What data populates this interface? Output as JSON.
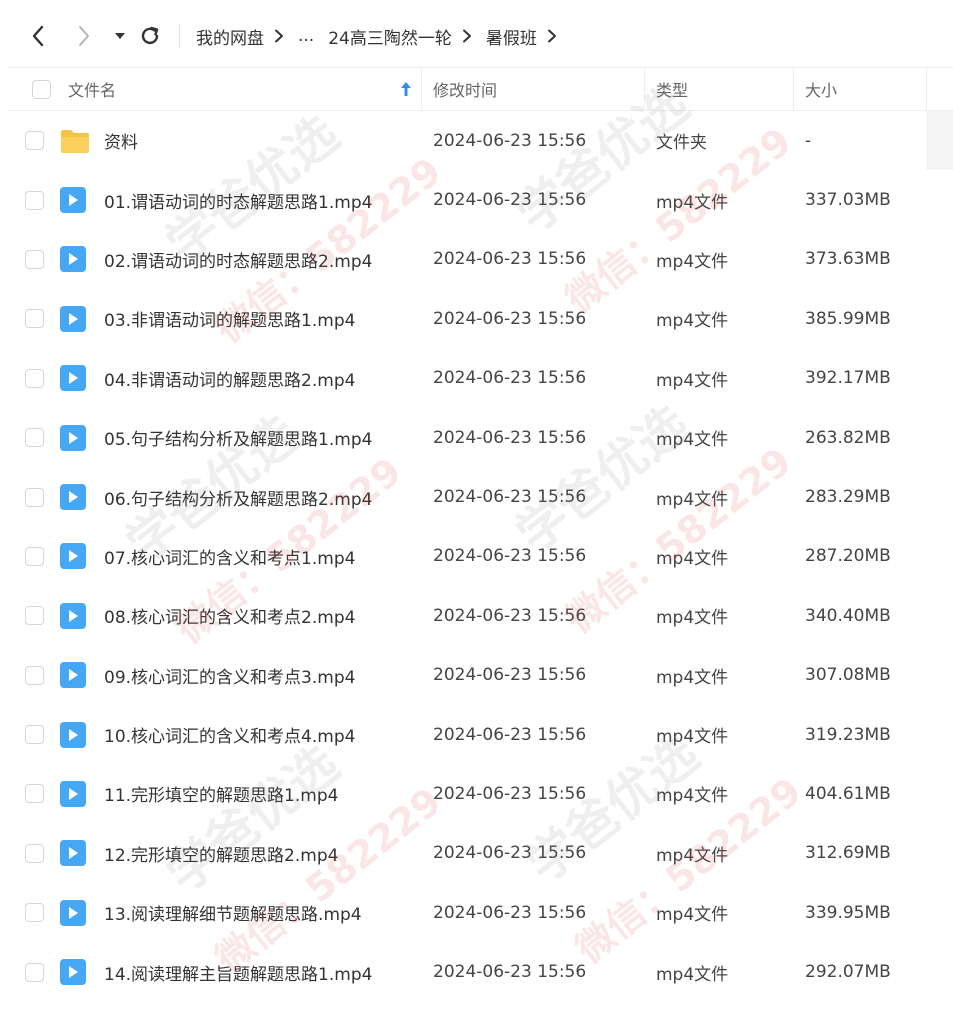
{
  "toolbar": {
    "back_icon": "chevron-left-icon",
    "forward_icon": "chevron-right-icon",
    "history_icon": "caret-down-icon",
    "refresh_icon": "refresh-icon"
  },
  "breadcrumb": {
    "items": [
      "我的网盘",
      "...",
      "24高三陶然一轮",
      "暑假班"
    ]
  },
  "columns": {
    "name": "文件名",
    "modified": "修改时间",
    "type": "类型",
    "size": "大小"
  },
  "colors": {
    "file_icon": "#46a8f5",
    "folder_icon": "#f7c343",
    "watermark": "#dc3c3c"
  },
  "files": [
    {
      "name": "资料",
      "modified": "2024-06-23 15:56",
      "type": "文件夹",
      "size": "-",
      "icon": "folder-icon"
    },
    {
      "name": "01.谓语动词的时态解题思路1.mp4",
      "modified": "2024-06-23 15:56",
      "type": "mp4文件",
      "size": "337.03MB",
      "icon": "video-file-icon"
    },
    {
      "name": "02.谓语动词的时态解题思路2.mp4",
      "modified": "2024-06-23 15:56",
      "type": "mp4文件",
      "size": "373.63MB",
      "icon": "video-file-icon"
    },
    {
      "name": "03.非谓语动词的解题思路1.mp4",
      "modified": "2024-06-23 15:56",
      "type": "mp4文件",
      "size": "385.99MB",
      "icon": "video-file-icon"
    },
    {
      "name": "04.非谓语动词的解题思路2.mp4",
      "modified": "2024-06-23 15:56",
      "type": "mp4文件",
      "size": "392.17MB",
      "icon": "video-file-icon"
    },
    {
      "name": "05.句子结构分析及解题思路1.mp4",
      "modified": "2024-06-23 15:56",
      "type": "mp4文件",
      "size": "263.82MB",
      "icon": "video-file-icon"
    },
    {
      "name": "06.句子结构分析及解题思路2.mp4",
      "modified": "2024-06-23 15:56",
      "type": "mp4文件",
      "size": "283.29MB",
      "icon": "video-file-icon"
    },
    {
      "name": "07.核心词汇的含义和考点1.mp4",
      "modified": "2024-06-23 15:56",
      "type": "mp4文件",
      "size": "287.20MB",
      "icon": "video-file-icon"
    },
    {
      "name": "08.核心词汇的含义和考点2.mp4",
      "modified": "2024-06-23 15:56",
      "type": "mp4文件",
      "size": "340.40MB",
      "icon": "video-file-icon"
    },
    {
      "name": "09.核心词汇的含义和考点3.mp4",
      "modified": "2024-06-23 15:56",
      "type": "mp4文件",
      "size": "307.08MB",
      "icon": "video-file-icon"
    },
    {
      "name": "10.核心词汇的含义和考点4.mp4",
      "modified": "2024-06-23 15:56",
      "type": "mp4文件",
      "size": "319.23MB",
      "icon": "video-file-icon"
    },
    {
      "name": "11.完形填空的解题思路1.mp4",
      "modified": "2024-06-23 15:56",
      "type": "mp4文件",
      "size": "404.61MB",
      "icon": "video-file-icon"
    },
    {
      "name": "12.完形填空的解题思路2.mp4",
      "modified": "2024-06-23 15:56",
      "type": "mp4文件",
      "size": "312.69MB",
      "icon": "video-file-icon"
    },
    {
      "name": "13.阅读理解细节题解题思路.mp4",
      "modified": "2024-06-23 15:56",
      "type": "mp4文件",
      "size": "339.95MB",
      "icon": "video-file-icon"
    },
    {
      "name": "14.阅读理解主旨题解题思路1.mp4",
      "modified": "2024-06-23 15:56",
      "type": "mp4文件",
      "size": "292.07MB",
      "icon": "video-file-icon"
    }
  ],
  "watermark": {
    "line1": "学爸优选",
    "line2": "微信：582229"
  }
}
